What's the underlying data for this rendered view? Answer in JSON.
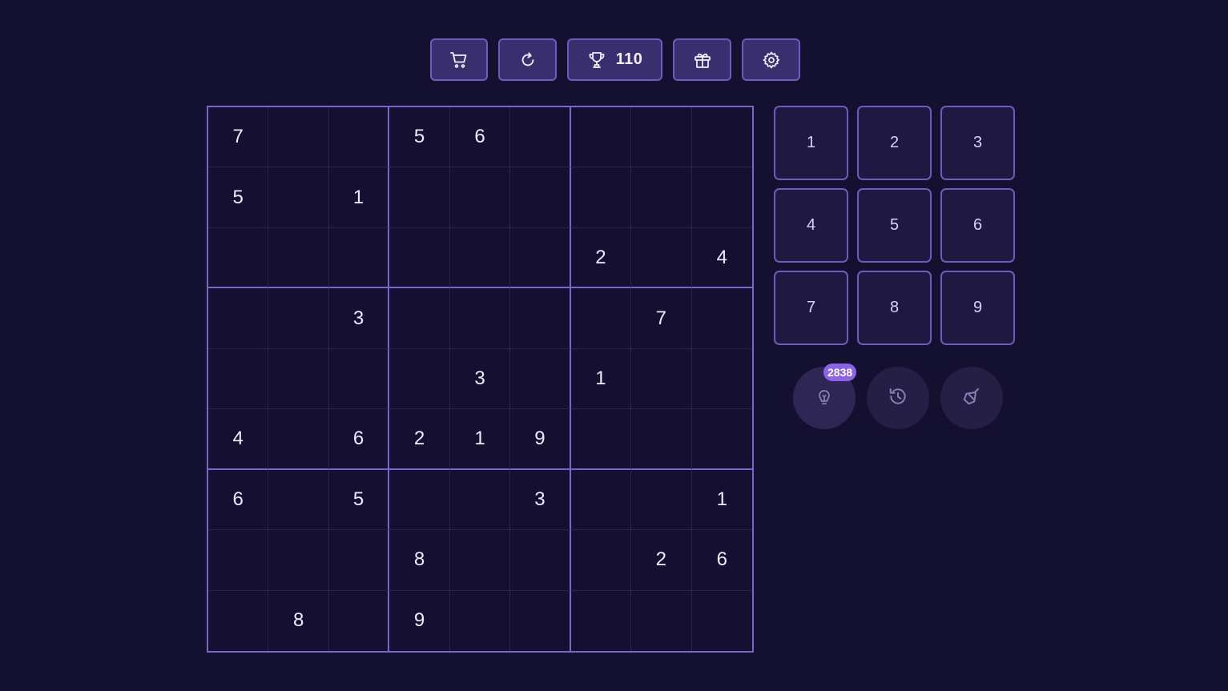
{
  "toolbar": {
    "shop_icon": "shopping-cart-icon",
    "restart_icon": "refresh-icon",
    "trophy_icon": "trophy-icon",
    "score": "110",
    "gift_icon": "gift-icon",
    "settings_icon": "gear-icon"
  },
  "board": {
    "grid": [
      [
        "7",
        "",
        "",
        "5",
        "6",
        "",
        "",
        "",
        ""
      ],
      [
        "5",
        "",
        "1",
        "",
        "",
        "",
        "",
        "",
        ""
      ],
      [
        "",
        "",
        "",
        "",
        "",
        "",
        "2",
        "",
        "4"
      ],
      [
        "",
        "",
        "3",
        "",
        "",
        "",
        "",
        "7",
        ""
      ],
      [
        "",
        "",
        "",
        "",
        "3",
        "",
        "1",
        "",
        ""
      ],
      [
        "4",
        "",
        "6",
        "2",
        "1",
        "9",
        "",
        "",
        ""
      ],
      [
        "6",
        "",
        "5",
        "",
        "",
        "3",
        "",
        "",
        "1"
      ],
      [
        "",
        "",
        "",
        "8",
        "",
        "",
        "",
        "2",
        "6"
      ],
      [
        "",
        "8",
        "",
        "9",
        "",
        "",
        "",
        "",
        ""
      ]
    ]
  },
  "numpad": {
    "keys": [
      "1",
      "2",
      "3",
      "4",
      "5",
      "6",
      "7",
      "8",
      "9"
    ]
  },
  "actions": {
    "hint_icon": "lightbulb-icon",
    "hint_count": "2838",
    "undo_icon": "undo-history-icon",
    "erase_icon": "eraser-icon"
  },
  "colors": {
    "background": "#141030",
    "accent": "#7a66c8",
    "toolbar_button": "#3a2f6e",
    "badge": "#8a63e8"
  }
}
